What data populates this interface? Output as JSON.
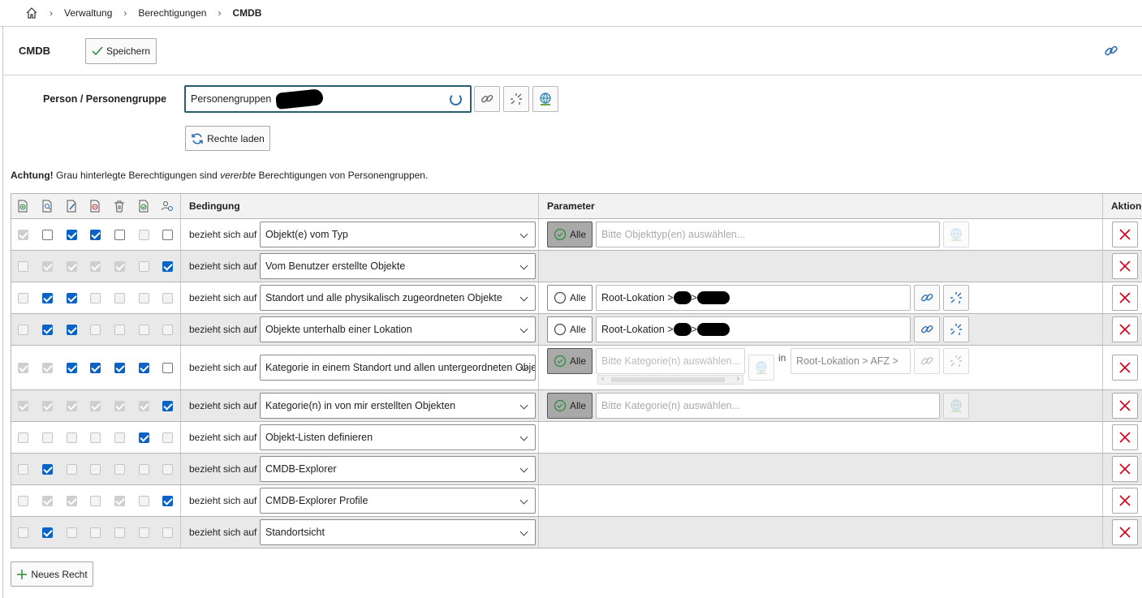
{
  "breadcrumb": {
    "items": [
      "Verwaltung",
      "Berechtigungen"
    ],
    "current": "CMDB"
  },
  "header": {
    "title": "CMDB",
    "save_label": "Speichern"
  },
  "person": {
    "label": "Person / Personengruppe",
    "value": "Personengruppen",
    "load_label": "Rechte laden"
  },
  "notice": {
    "bold": "Achtung!",
    "text1": " Grau hinterlegte Berechtigungen sind ",
    "italic": "vererbte",
    "text2": " Berechtigungen von Personengruppen."
  },
  "table": {
    "headers": {
      "condition": "Bedingung",
      "parameter": "Parameter",
      "action": "Aktion"
    },
    "permission_icons": [
      "create-icon",
      "view-icon",
      "edit-icon",
      "archive-icon",
      "delete-icon",
      "execute-icon",
      "supervisor-icon"
    ],
    "ref_label": "bezieht sich auf",
    "alle_label": "Alle",
    "in_label": "in",
    "rows": [
      {
        "perms": [
          [
            1,
            1
          ],
          [
            0,
            0
          ],
          [
            1,
            0
          ],
          [
            1,
            0
          ],
          [
            0,
            0
          ],
          [
            0,
            1
          ],
          [
            0,
            0
          ]
        ],
        "condition": "Objekt(e) vom Typ",
        "param": {
          "type": "typ",
          "alle": true,
          "placeholder": "Bitte Objekttyp(en) auswählen..."
        }
      },
      {
        "perms": [
          [
            0,
            1
          ],
          [
            1,
            1
          ],
          [
            1,
            1
          ],
          [
            1,
            1
          ],
          [
            1,
            1
          ],
          [
            0,
            1
          ],
          [
            1,
            0
          ]
        ],
        "condition": "Vom Benutzer erstellte Objekte",
        "param": {
          "type": "none"
        }
      },
      {
        "perms": [
          [
            0,
            1
          ],
          [
            1,
            0
          ],
          [
            1,
            0
          ],
          [
            0,
            1
          ],
          [
            0,
            1
          ],
          [
            0,
            1
          ],
          [
            0,
            1
          ]
        ],
        "condition": "Standort und alle physikalisch zugeordneten Objekte",
        "param": {
          "type": "loc",
          "alle": false,
          "value": "Root-Lokation > ",
          "mid": " > "
        }
      },
      {
        "perms": [
          [
            0,
            1
          ],
          [
            1,
            0
          ],
          [
            1,
            0
          ],
          [
            0,
            1
          ],
          [
            0,
            1
          ],
          [
            0,
            1
          ],
          [
            0,
            1
          ]
        ],
        "condition": "Objekte unterhalb einer Lokation",
        "param": {
          "type": "loc",
          "alle": false,
          "value": "Root-Lokation > ",
          "mid": " > "
        }
      },
      {
        "perms": [
          [
            1,
            1
          ],
          [
            1,
            1
          ],
          [
            1,
            0
          ],
          [
            1,
            0
          ],
          [
            1,
            0
          ],
          [
            1,
            0
          ],
          [
            0,
            0
          ]
        ],
        "condition": "Kategorie in einem Standort und allen untergeordneten Objekten",
        "param": {
          "type": "catloc",
          "alle": true,
          "placeholder": "Bitte Kategorie(n) auswählen...",
          "location": "Root-Lokation > AFZ >"
        }
      },
      {
        "perms": [
          [
            1,
            1
          ],
          [
            1,
            1
          ],
          [
            1,
            1
          ],
          [
            1,
            1
          ],
          [
            1,
            1
          ],
          [
            1,
            1
          ],
          [
            1,
            0
          ]
        ],
        "condition": "Kategorie(n) in von mir erstellten Objekten",
        "param": {
          "type": "typ",
          "alle": true,
          "placeholder": "Bitte Kategorie(n) auswählen..."
        }
      },
      {
        "perms": [
          [
            0,
            1
          ],
          [
            0,
            1
          ],
          [
            0,
            1
          ],
          [
            0,
            1
          ],
          [
            0,
            1
          ],
          [
            1,
            0
          ],
          [
            0,
            1
          ]
        ],
        "condition": "Objekt-Listen definieren",
        "param": {
          "type": "none"
        }
      },
      {
        "perms": [
          [
            0,
            1
          ],
          [
            1,
            0
          ],
          [
            0,
            1
          ],
          [
            0,
            1
          ],
          [
            0,
            1
          ],
          [
            0,
            1
          ],
          [
            0,
            1
          ]
        ],
        "condition": "CMDB-Explorer",
        "param": {
          "type": "none"
        }
      },
      {
        "perms": [
          [
            0,
            1
          ],
          [
            1,
            1
          ],
          [
            1,
            1
          ],
          [
            0,
            1
          ],
          [
            1,
            1
          ],
          [
            0,
            1
          ],
          [
            1,
            0
          ]
        ],
        "condition": "CMDB-Explorer Profile",
        "param": {
          "type": "none"
        }
      },
      {
        "perms": [
          [
            0,
            1
          ],
          [
            1,
            0
          ],
          [
            0,
            1
          ],
          [
            0,
            1
          ],
          [
            0,
            1
          ],
          [
            0,
            1
          ],
          [
            0,
            1
          ]
        ],
        "condition": "Standortsicht",
        "param": {
          "type": "none"
        }
      }
    ]
  },
  "new_right_label": "Neues Recht",
  "colors": {
    "checkbox_on": "#0b63c5",
    "inherited_row": "#e9e9e9",
    "delete_red": "#d0021b",
    "focus_border": "#2a5d6e"
  }
}
